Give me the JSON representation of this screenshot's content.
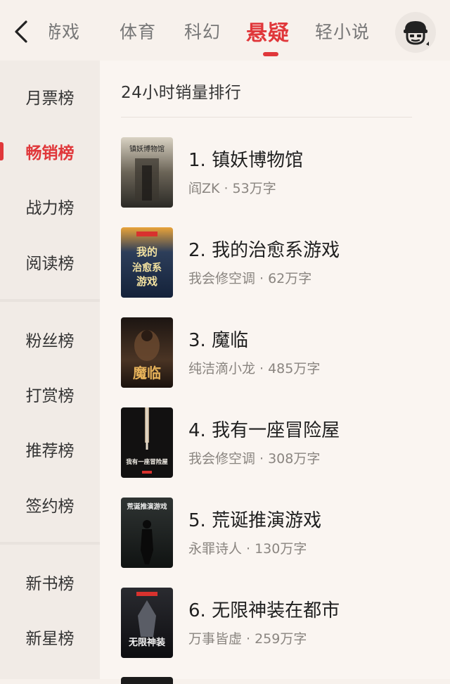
{
  "header": {
    "tabs": [
      {
        "label": "游戏",
        "active": false
      },
      {
        "label": "体育",
        "active": false
      },
      {
        "label": "科幻",
        "active": false
      },
      {
        "label": "悬疑",
        "active": true
      },
      {
        "label": "轻小说",
        "active": false
      }
    ]
  },
  "sidebar": {
    "items": [
      {
        "label": "月票榜",
        "active": false
      },
      {
        "label": "畅销榜",
        "active": true
      },
      {
        "label": "战力榜",
        "active": false
      },
      {
        "label": "阅读榜",
        "active": false
      },
      {
        "label": "粉丝榜",
        "active": false
      },
      {
        "label": "打赏榜",
        "active": false
      },
      {
        "label": "推荐榜",
        "active": false
      },
      {
        "label": "签约榜",
        "active": false
      },
      {
        "label": "新书榜",
        "active": false
      },
      {
        "label": "新星榜",
        "active": false
      }
    ]
  },
  "main": {
    "section_title": "24小时销量排行",
    "books": [
      {
        "title": "1. 镇妖博物馆",
        "author": "阎ZK",
        "words": "53万字",
        "cover_text": "镇妖博物馆"
      },
      {
        "title": "2. 我的治愈系游戏",
        "author": "我会修空调",
        "words": "62万字",
        "cover_text": "我的治愈系游戏"
      },
      {
        "title": "3. 魔临",
        "author": "纯洁滴小龙",
        "words": "485万字",
        "cover_text": "魔临"
      },
      {
        "title": "4. 我有一座冒险屋",
        "author": "我会修空调",
        "words": "308万字",
        "cover_text": "我有一座冒险屋"
      },
      {
        "title": "5. 荒诞推演游戏",
        "author": "永罪诗人",
        "words": "130万字",
        "cover_text": "荒诞推演游戏"
      },
      {
        "title": "6. 无限神装在都市",
        "author": "万事皆虚",
        "words": "259万字",
        "cover_text": "无限神装"
      }
    ]
  },
  "colors": {
    "accent": "#e0373a",
    "background": "#f7f1ec"
  },
  "icons": {
    "back": "chevron-left-icon",
    "profile": "avatar-icon"
  }
}
